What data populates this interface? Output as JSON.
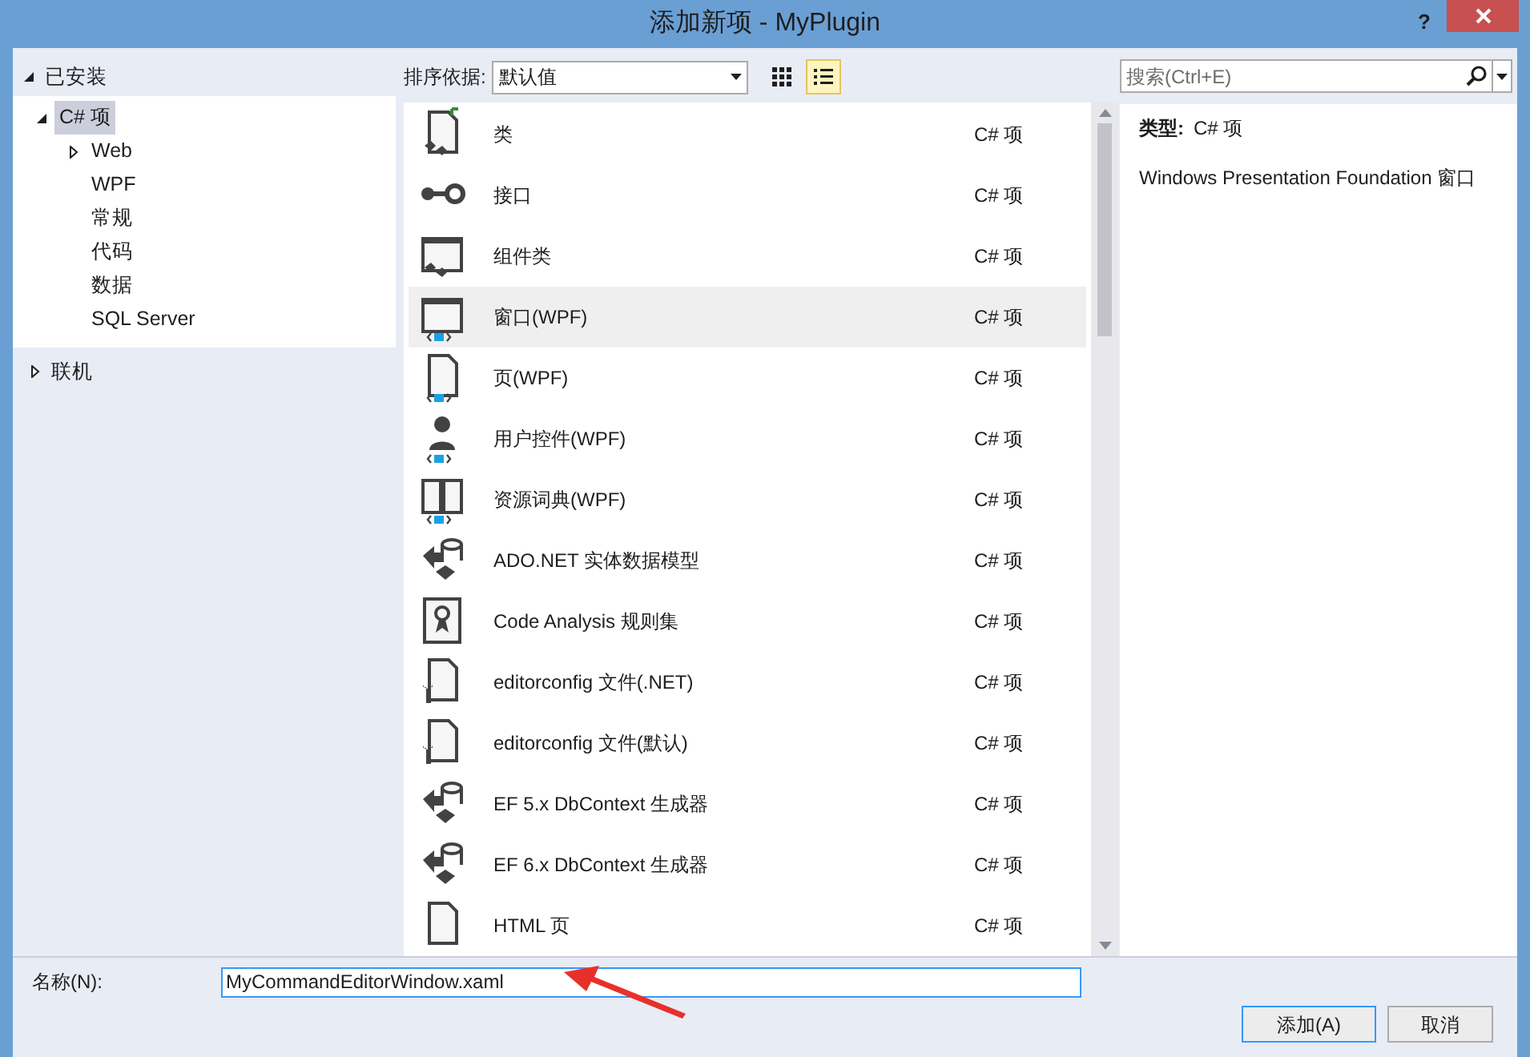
{
  "window": {
    "title": "添加新项 - MyPlugin",
    "help": "?"
  },
  "sidebar": {
    "installed": {
      "label": "已安装",
      "expanded": true,
      "children": [
        {
          "label": "C# 项",
          "selected": true,
          "expanded": true,
          "children": [
            {
              "label": "Web",
              "selected": false,
              "expanded": false
            },
            {
              "label": "WPF",
              "selected": false
            },
            {
              "label": "常规",
              "selected": false
            },
            {
              "label": "代码",
              "selected": false
            },
            {
              "label": "数据",
              "selected": false
            },
            {
              "label": "SQL Server",
              "selected": false
            }
          ]
        }
      ]
    },
    "online": {
      "label": "联机",
      "expanded": false
    }
  },
  "toolbar": {
    "sort_label": "排序依据:",
    "sort_value": "默认值",
    "views": [
      {
        "kind": "grid",
        "selected": false
      },
      {
        "kind": "list",
        "selected": true
      }
    ],
    "search": {
      "placeholder": "搜索(Ctrl+E)"
    }
  },
  "items": [
    {
      "kind": "class",
      "name": "类",
      "type": "C# 项",
      "selected": false
    },
    {
      "kind": "interface",
      "name": "接口",
      "type": "C# 项",
      "selected": false
    },
    {
      "kind": "component",
      "name": "组件类",
      "type": "C# 项",
      "selected": false
    },
    {
      "kind": "window",
      "name": "窗口(WPF)",
      "type": "C# 项",
      "selected": true
    },
    {
      "kind": "page",
      "name": "页(WPF)",
      "type": "C# 项",
      "selected": false
    },
    {
      "kind": "usercontrol",
      "name": "用户控件(WPF)",
      "type": "C# 项",
      "selected": false
    },
    {
      "kind": "dictionary",
      "name": "资源词典(WPF)",
      "type": "C# 项",
      "selected": false
    },
    {
      "kind": "model",
      "name": "ADO.NET 实体数据模型",
      "type": "C# 项",
      "selected": false
    },
    {
      "kind": "ruleset",
      "name": "Code Analysis 规则集",
      "type": "C# 项",
      "selected": false
    },
    {
      "kind": "config",
      "name": "editorconfig 文件(.NET)",
      "type": "C# 项",
      "selected": false
    },
    {
      "kind": "config",
      "name": "editorconfig 文件(默认)",
      "type": "C# 项",
      "selected": false
    },
    {
      "kind": "model",
      "name": "EF 5.x DbContext 生成器",
      "type": "C# 项",
      "selected": false
    },
    {
      "kind": "model",
      "name": "EF 6.x DbContext 生成器",
      "type": "C# 项",
      "selected": false
    },
    {
      "kind": "file",
      "name": "HTML 页",
      "type": "C# 项",
      "selected": false
    }
  ],
  "details": {
    "type_label": "类型:",
    "type_value": "C# 项",
    "description": "Windows Presentation Foundation 窗口"
  },
  "name_field": {
    "label": "名称(N):",
    "value": "MyCommandEditorWindow.xaml"
  },
  "buttons": [
    {
      "label": "添加(A)",
      "default": true
    },
    {
      "label": "取消",
      "default": false
    }
  ]
}
